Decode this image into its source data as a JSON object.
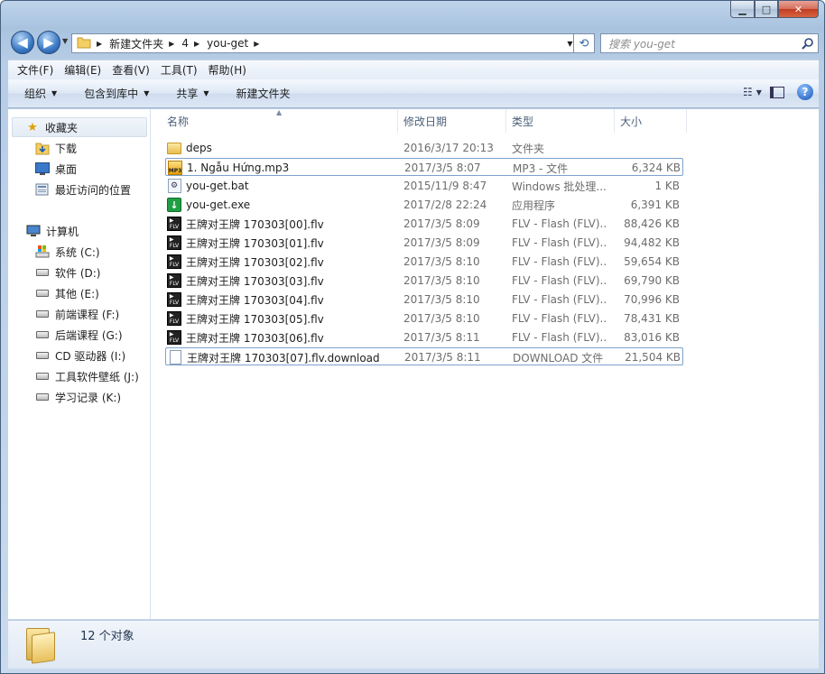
{
  "window": {
    "caption_buttons": {
      "minimize": "▁",
      "maximize": "□",
      "close": "✕"
    }
  },
  "nav": {
    "back": "◀",
    "forward": "▶",
    "breadcrumb": [
      "新建文件夹",
      "4",
      "you-get"
    ],
    "search_placeholder": "搜索 you-get"
  },
  "menu": [
    "文件(F)",
    "编辑(E)",
    "查看(V)",
    "工具(T)",
    "帮助(H)"
  ],
  "commands": [
    {
      "label": "组织",
      "dropdown": true
    },
    {
      "label": "包含到库中",
      "dropdown": true
    },
    {
      "label": "共享",
      "dropdown": true
    },
    {
      "label": "新建文件夹",
      "dropdown": false
    }
  ],
  "sidebar": {
    "favorites": {
      "label": "收藏夹",
      "icon": "star-icon"
    },
    "favorite_items": [
      {
        "label": "下载",
        "icon": "download-folder-icon"
      },
      {
        "label": "桌面",
        "icon": "desktop-icon"
      },
      {
        "label": "最近访问的位置",
        "icon": "recent-places-icon"
      }
    ],
    "computer": {
      "label": "计算机",
      "icon": "computer-icon"
    },
    "drives": [
      {
        "label": "系统 (C:)",
        "icon": "system-drive-icon"
      },
      {
        "label": "软件 (D:)",
        "icon": "drive-icon"
      },
      {
        "label": "其他 (E:)",
        "icon": "drive-icon"
      },
      {
        "label": "前端课程 (F:)",
        "icon": "drive-icon"
      },
      {
        "label": "后端课程 (G:)",
        "icon": "drive-icon"
      },
      {
        "label": "CD 驱动器 (I:)",
        "icon": "cd-drive-icon"
      },
      {
        "label": "工具软件壁纸 (J:)",
        "icon": "drive-icon"
      },
      {
        "label": "学习记录 (K:)",
        "icon": "drive-icon"
      }
    ]
  },
  "columns": {
    "name": "名称",
    "date": "修改日期",
    "type": "类型",
    "size": "大小"
  },
  "files": [
    {
      "name": "deps",
      "date": "2016/3/17 20:13",
      "type": "文件夹",
      "size": "",
      "icon": "folder-icon"
    },
    {
      "name": "1. Ngẫu Hứng.mp3",
      "date": "2017/3/5 8:07",
      "type": "MP3 - 文件",
      "size": "6,324 KB",
      "icon": "mp3-icon"
    },
    {
      "name": "you-get.bat",
      "date": "2015/11/9 8:47",
      "type": "Windows 批处理...",
      "size": "1 KB",
      "icon": "bat-file-icon"
    },
    {
      "name": "you-get.exe",
      "date": "2017/2/8 22:24",
      "type": "应用程序",
      "size": "6,391 KB",
      "icon": "exe-icon"
    },
    {
      "name": "王牌对王牌 170303[00].flv",
      "date": "2017/3/5 8:09",
      "type": "FLV - Flash (FLV)...",
      "size": "88,426 KB",
      "icon": "flv-icon"
    },
    {
      "name": "王牌对王牌 170303[01].flv",
      "date": "2017/3/5 8:09",
      "type": "FLV - Flash (FLV)...",
      "size": "94,482 KB",
      "icon": "flv-icon"
    },
    {
      "name": "王牌对王牌 170303[02].flv",
      "date": "2017/3/5 8:10",
      "type": "FLV - Flash (FLV)...",
      "size": "59,654 KB",
      "icon": "flv-icon"
    },
    {
      "name": "王牌对王牌 170303[03].flv",
      "date": "2017/3/5 8:10",
      "type": "FLV - Flash (FLV)...",
      "size": "69,790 KB",
      "icon": "flv-icon"
    },
    {
      "name": "王牌对王牌 170303[04].flv",
      "date": "2017/3/5 8:10",
      "type": "FLV - Flash (FLV)...",
      "size": "70,996 KB",
      "icon": "flv-icon"
    },
    {
      "name": "王牌对王牌 170303[05].flv",
      "date": "2017/3/5 8:10",
      "type": "FLV - Flash (FLV)...",
      "size": "78,431 KB",
      "icon": "flv-icon"
    },
    {
      "name": "王牌对王牌 170303[06].flv",
      "date": "2017/3/5 8:11",
      "type": "FLV - Flash (FLV)...",
      "size": "83,016 KB",
      "icon": "flv-icon"
    },
    {
      "name": "王牌对王牌 170303[07].flv.download",
      "date": "2017/3/5 8:11",
      "type": "DOWNLOAD 文件",
      "size": "21,504 KB",
      "icon": "file-icon"
    }
  ],
  "status": {
    "count_text": "12 个对象"
  },
  "colors": {
    "accent": "#3a78c4",
    "selection_border": "#7da2ce"
  }
}
